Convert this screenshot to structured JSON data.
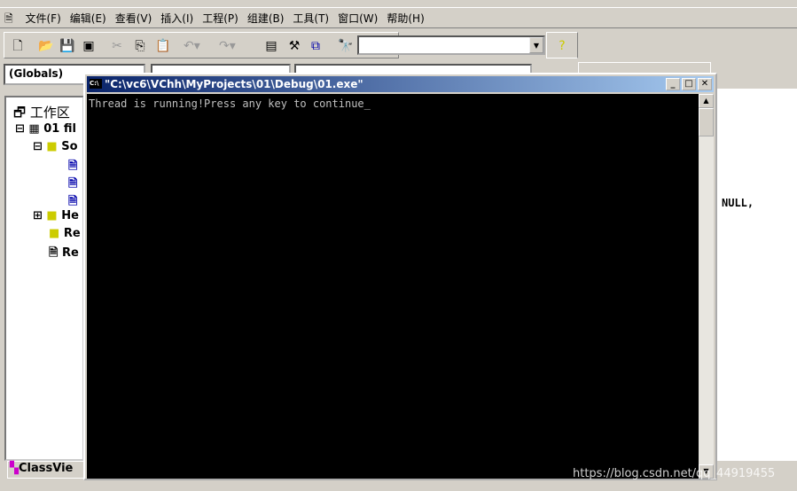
{
  "menu": [
    "文件(F)",
    "编辑(E)",
    "查看(V)",
    "插入(I)",
    "工程(P)",
    "组建(B)",
    "工具(T)",
    "窗口(W)",
    "帮助(H)"
  ],
  "toolbar": {
    "find_combo": ""
  },
  "wizard": {
    "scope": "(Globals)"
  },
  "workspace": {
    "root": "工作区",
    "project": "01 fil",
    "folders": [
      "So",
      "He",
      "Re",
      "Re"
    ],
    "tab": "ClassVie"
  },
  "editor": {
    "visible_text": "NULL,"
  },
  "console": {
    "title": "\"C:\\vc6\\VChh\\MyProjects\\01\\Debug\\01.exe\"",
    "output": "Thread is running!Press any key to continue"
  },
  "watermark": "https://blog.csdn.net/qq_44919455"
}
